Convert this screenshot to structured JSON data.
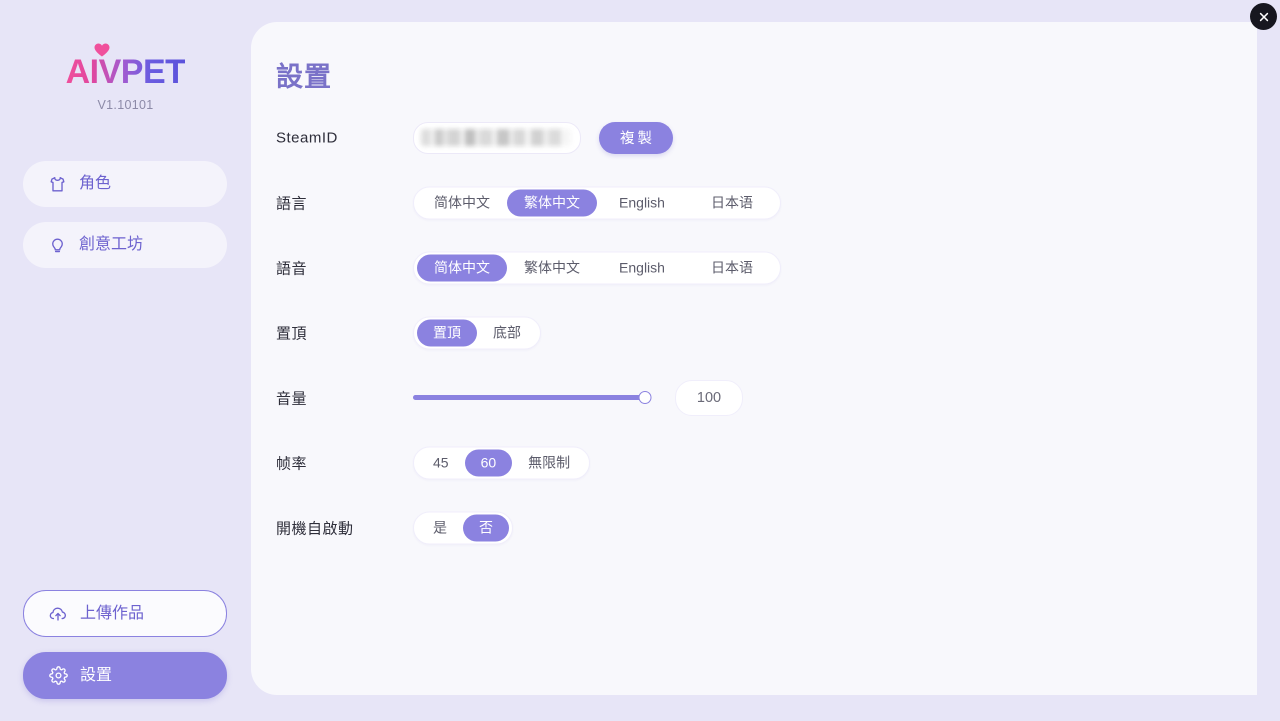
{
  "app": {
    "logo_text": "AIVPET",
    "version": "V1.10101"
  },
  "sidebar": {
    "top_items": [
      {
        "label": "角色",
        "icon": "shirt-icon"
      },
      {
        "label": "創意工坊",
        "icon": "lightbulb-icon"
      }
    ],
    "bottom_items": [
      {
        "label": "上傳作品",
        "icon": "cloud-upload-icon",
        "state": "outlined"
      },
      {
        "label": "設置",
        "icon": "gear-icon",
        "state": "active"
      }
    ]
  },
  "window": {
    "close_label": "×"
  },
  "main": {
    "title": "設置",
    "rows": {
      "steamid": {
        "label": "SteamID",
        "value": "",
        "redacted": true,
        "copy_label": "複製"
      },
      "language": {
        "label": "語言",
        "options": [
          "简体中文",
          "繁体中文",
          "English",
          "日本语"
        ],
        "selected": "繁体中文"
      },
      "voice": {
        "label": "語音",
        "options": [
          "简体中文",
          "繁体中文",
          "English",
          "日本语"
        ],
        "selected": "简体中文"
      },
      "pin": {
        "label": "置頂",
        "options": [
          "置頂",
          "底部"
        ],
        "selected": "置頂"
      },
      "volume": {
        "label": "音量",
        "value": "100",
        "percent": 100
      },
      "framerate": {
        "label": "帧率",
        "options": [
          "45",
          "60",
          "無限制"
        ],
        "selected": "60"
      },
      "autostart": {
        "label": "開機自啟動",
        "options": [
          "是",
          "否"
        ],
        "selected": "否"
      }
    }
  },
  "colors": {
    "accent": "#8b82e0",
    "accent_text": "#6d62cf",
    "title": "#7a72c8",
    "page_bg": "#e7e5f7",
    "panel_bg": "#f8f8fc"
  }
}
